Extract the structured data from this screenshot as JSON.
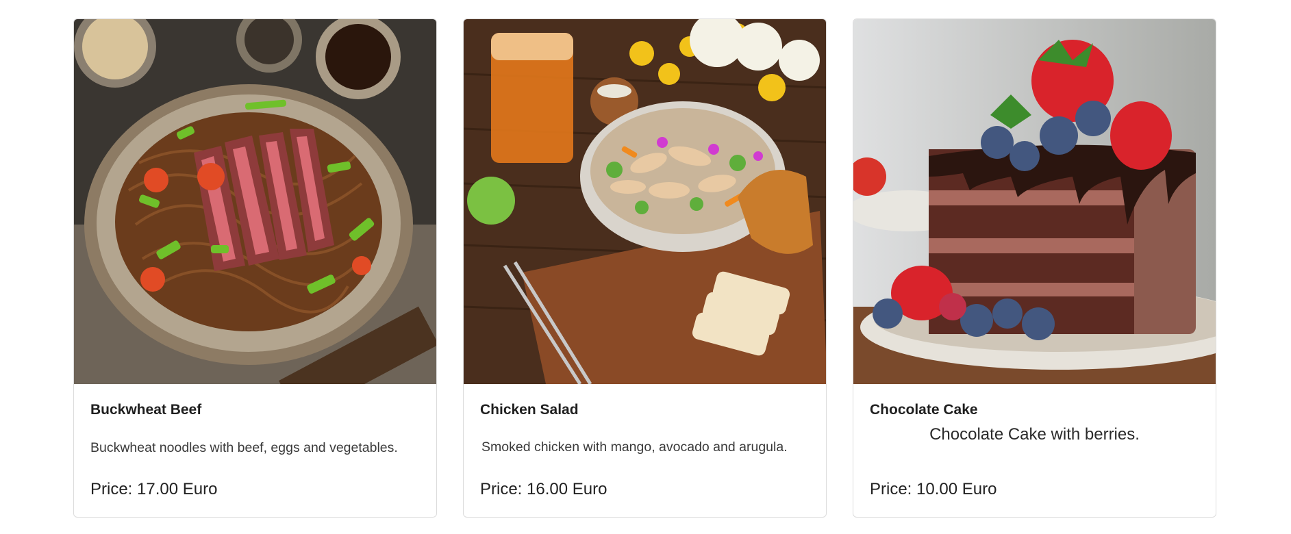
{
  "cards": [
    {
      "title": "Buckwheat Beef",
      "description": "Buckwheat noodles with beef, eggs and vegetables.",
      "price": "Price: 17.00 Euro"
    },
    {
      "title": "Chicken Salad",
      "description": "Smoked chicken with mango, avocado and arugula.",
      "price": "Price: 16.00 Euro"
    },
    {
      "title": "Chocolate Cake",
      "description": "Chocolate Cake with berries.",
      "price": "Price: 10.00 Euro"
    }
  ]
}
